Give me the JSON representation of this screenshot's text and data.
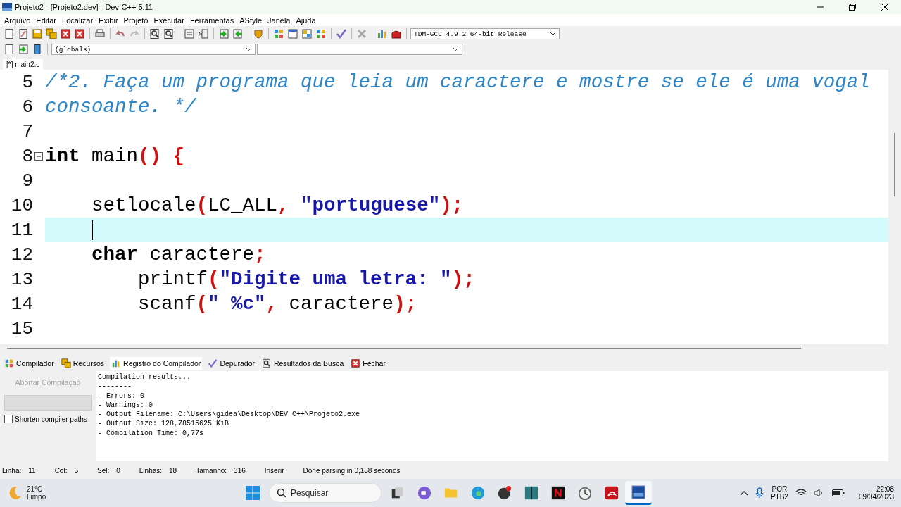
{
  "window": {
    "title": "Projeto2 - [Projeto2.dev] - Dev-C++ 5.11"
  },
  "menu": [
    "Arquivo",
    "Editar",
    "Localizar",
    "Exibir",
    "Projeto",
    "Executar",
    "Ferramentas",
    "AStyle",
    "Janela",
    "Ajuda"
  ],
  "compiler_select": {
    "value": "TDM-GCC 4.9.2 64-bit Release"
  },
  "scope_select": {
    "value": "(globals)"
  },
  "file_tabs": [
    {
      "label": "[*] main2.c",
      "selected": true
    }
  ],
  "editor": {
    "lines": [
      {
        "number": "5",
        "current": false,
        "foldable": false,
        "tokens": [
          {
            "kind": "comment",
            "text": "/*2. Faça um programa que leia um caractere e mostre se ele é uma vogal"
          }
        ]
      },
      {
        "number": "6",
        "current": false,
        "foldable": false,
        "tokens": [
          {
            "kind": "comment",
            "text": "consoante. */"
          }
        ]
      },
      {
        "number": "7",
        "current": false,
        "foldable": false
      },
      {
        "number": "8",
        "current": false,
        "foldable": true,
        "tokens": [
          {
            "kind": "keyword",
            "text": "int"
          },
          {
            "kind": "plain",
            "text": " main"
          },
          {
            "kind": "symbol",
            "text": "()"
          },
          {
            "kind": "symbol",
            "text": " {"
          }
        ]
      },
      {
        "number": "9",
        "current": false,
        "foldable": false
      },
      {
        "number": "10",
        "current": false,
        "foldable": false,
        "tokens": [
          {
            "kind": "plain",
            "text": "    setlocale"
          },
          {
            "kind": "symbol",
            "text": "("
          },
          {
            "kind": "plain",
            "text": "LC_ALL"
          },
          {
            "kind": "symbol",
            "text": ","
          },
          {
            "kind": "string",
            "text": " \"portuguese\""
          },
          {
            "kind": "symbol",
            "text": ");"
          }
        ]
      },
      {
        "number": "11",
        "current": true,
        "foldable": false
      },
      {
        "number": "12",
        "current": false,
        "foldable": false,
        "tokens": [
          {
            "kind": "keyword",
            "text": "    char"
          },
          {
            "kind": "plain",
            "text": " caractere"
          },
          {
            "kind": "symbol",
            "text": ";"
          }
        ]
      },
      {
        "number": "13",
        "current": false,
        "foldable": false,
        "tokens": [
          {
            "kind": "plain",
            "text": "        printf"
          },
          {
            "kind": "symbol",
            "text": "("
          },
          {
            "kind": "string",
            "text": "\"Digite uma letra: \""
          },
          {
            "kind": "symbol",
            "text": ");"
          }
        ]
      },
      {
        "number": "14",
        "current": false,
        "foldable": false,
        "tokens": [
          {
            "kind": "plain",
            "text": "        scanf"
          },
          {
            "kind": "symbol",
            "text": "("
          },
          {
            "kind": "string",
            "text": "\" %c\""
          },
          {
            "kind": "symbol",
            "text": ","
          },
          {
            "kind": "plain",
            "text": " caractere"
          },
          {
            "kind": "symbol",
            "text": ");"
          }
        ]
      },
      {
        "number": "15",
        "current": false,
        "foldable": false
      }
    ]
  },
  "bottom_tabs": [
    {
      "label": "Compilador",
      "kind": "grid",
      "selected": false
    },
    {
      "label": "Recursos",
      "kind": "stack",
      "selected": false
    },
    {
      "label": "Registro do Compilador",
      "kind": "chart",
      "selected": true
    },
    {
      "label": "Depurador",
      "kind": "check",
      "selected": false
    },
    {
      "label": "Resultados da Busca",
      "kind": "find",
      "selected": false
    },
    {
      "label": "Fechar",
      "kind": "close",
      "selected": false
    }
  ],
  "compile_panel": {
    "abort_button": {
      "label": "Abortar Compilação",
      "disabled": true
    },
    "progress": {
      "level": 0
    },
    "shorten_paths": {
      "label": "Shorten compiler paths",
      "checked": false
    },
    "output": [
      "Compilation results...",
      "--------",
      "- Errors: 0",
      "- Warnings: 0",
      "- Output Filename: C:\\Users\\gidea\\Desktop\\DEV C++\\Projeto2.exe",
      "- Output Size: 128,78515625 KiB",
      "- Compilation Time: 0,77s"
    ]
  },
  "status_bar": [
    {
      "label": "Linha:",
      "value": "11"
    },
    {
      "label": "Col:",
      "value": "5"
    },
    {
      "label": "Sel:",
      "value": "0"
    },
    {
      "label": "Linhas:",
      "value": "18"
    },
    {
      "label": "Tamanho:",
      "value": "316"
    },
    {
      "label": "Inserir"
    },
    {
      "label": "Done parsing in 0,188 seconds"
    }
  ],
  "taskbar": {
    "weather": {
      "temperature": "21°C",
      "condition": "Limpo"
    },
    "search": {
      "placeholder": "Pesquisar"
    },
    "apps": [
      {
        "kind": "taskview",
        "selected": false
      },
      {
        "kind": "chat",
        "selected": false
      },
      {
        "kind": "folder",
        "selected": false
      },
      {
        "kind": "browser",
        "selected": false
      },
      {
        "kind": "recorder",
        "selected": false
      },
      {
        "kind": "book",
        "selected": false
      },
      {
        "kind": "video",
        "selected": false
      },
      {
        "kind": "clock",
        "selected": false
      },
      {
        "kind": "pdf",
        "selected": false
      },
      {
        "kind": "ide",
        "selected": true
      }
    ],
    "language": {
      "line1": "POR",
      "line2": "PTB2"
    },
    "time": "22:08",
    "date": "09/04/2023"
  }
}
